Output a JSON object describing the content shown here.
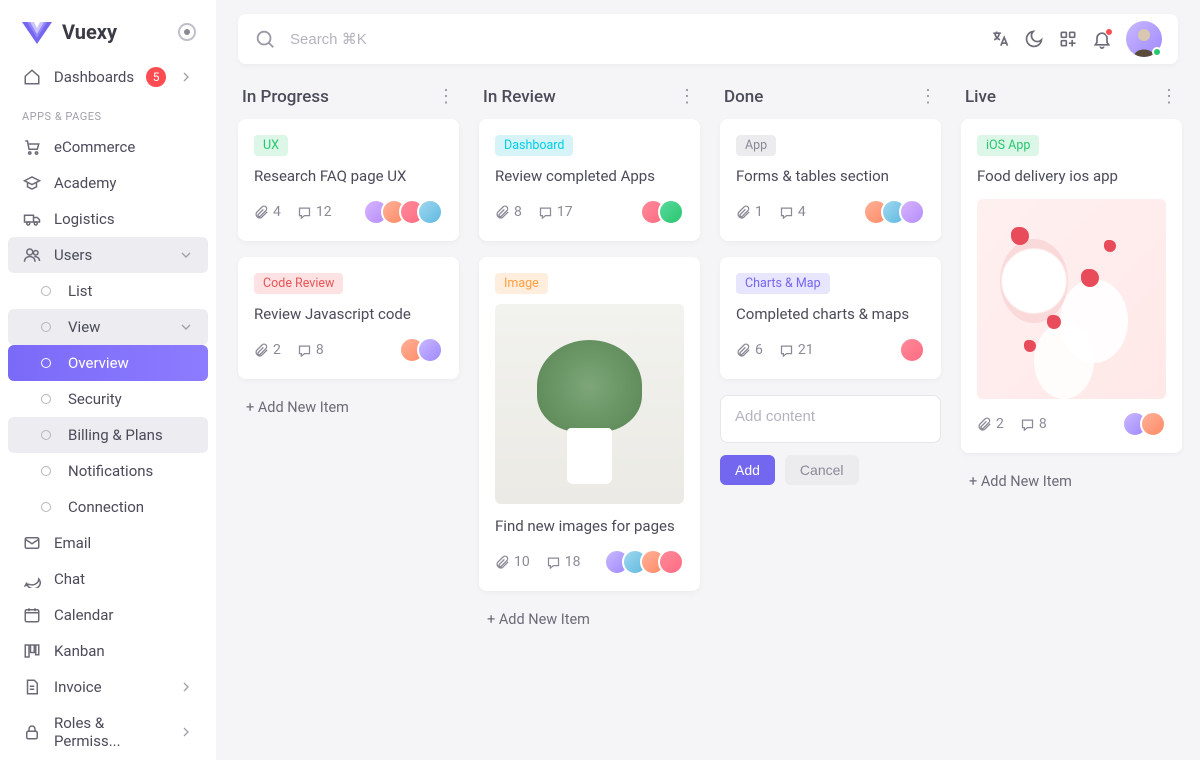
{
  "brand": "Vuexy",
  "search_placeholder": "Search ⌘K",
  "sidebar": {
    "dashboards": "Dashboards",
    "dashboards_badge": "5",
    "section_apps": "APPS & PAGES",
    "ecommerce": "eCommerce",
    "academy": "Academy",
    "logistics": "Logistics",
    "users": "Users",
    "list": "List",
    "view": "View",
    "overview": "Overview",
    "security": "Security",
    "billing": "Billing & Plans",
    "notifications": "Notifications",
    "connection": "Connection",
    "email": "Email",
    "chat": "Chat",
    "calendar": "Calendar",
    "kanban": "Kanban",
    "invoice": "Invoice",
    "roles": "Roles & Permiss..."
  },
  "board": {
    "col0": {
      "title": "In Progress",
      "add": "+ Add New Item",
      "c0": {
        "tag": "UX",
        "title": "Research FAQ page UX",
        "attach": "4",
        "comments": "12"
      },
      "c1": {
        "tag": "Code Review",
        "title": "Review Javascript code",
        "attach": "2",
        "comments": "8"
      }
    },
    "col1": {
      "title": "In Review",
      "add": "+ Add New Item",
      "c0": {
        "tag": "Dashboard",
        "title": "Review completed Apps",
        "attach": "8",
        "comments": "17"
      },
      "c1": {
        "tag": "Image",
        "title": "Find new images for pages",
        "attach": "10",
        "comments": "18"
      }
    },
    "col2": {
      "title": "Done",
      "c0": {
        "tag": "App",
        "title": "Forms & tables section",
        "attach": "1",
        "comments": "4"
      },
      "c1": {
        "tag": "Charts & Map",
        "title": "Completed charts & maps",
        "attach": "6",
        "comments": "21"
      },
      "new_placeholder": "Add content",
      "add_btn": "Add",
      "cancel_btn": "Cancel"
    },
    "col3": {
      "title": "Live",
      "add": "+ Add New Item",
      "c0": {
        "tag": "iOS App",
        "title": "Food delivery ios app",
        "attach": "2",
        "comments": "8"
      }
    }
  }
}
